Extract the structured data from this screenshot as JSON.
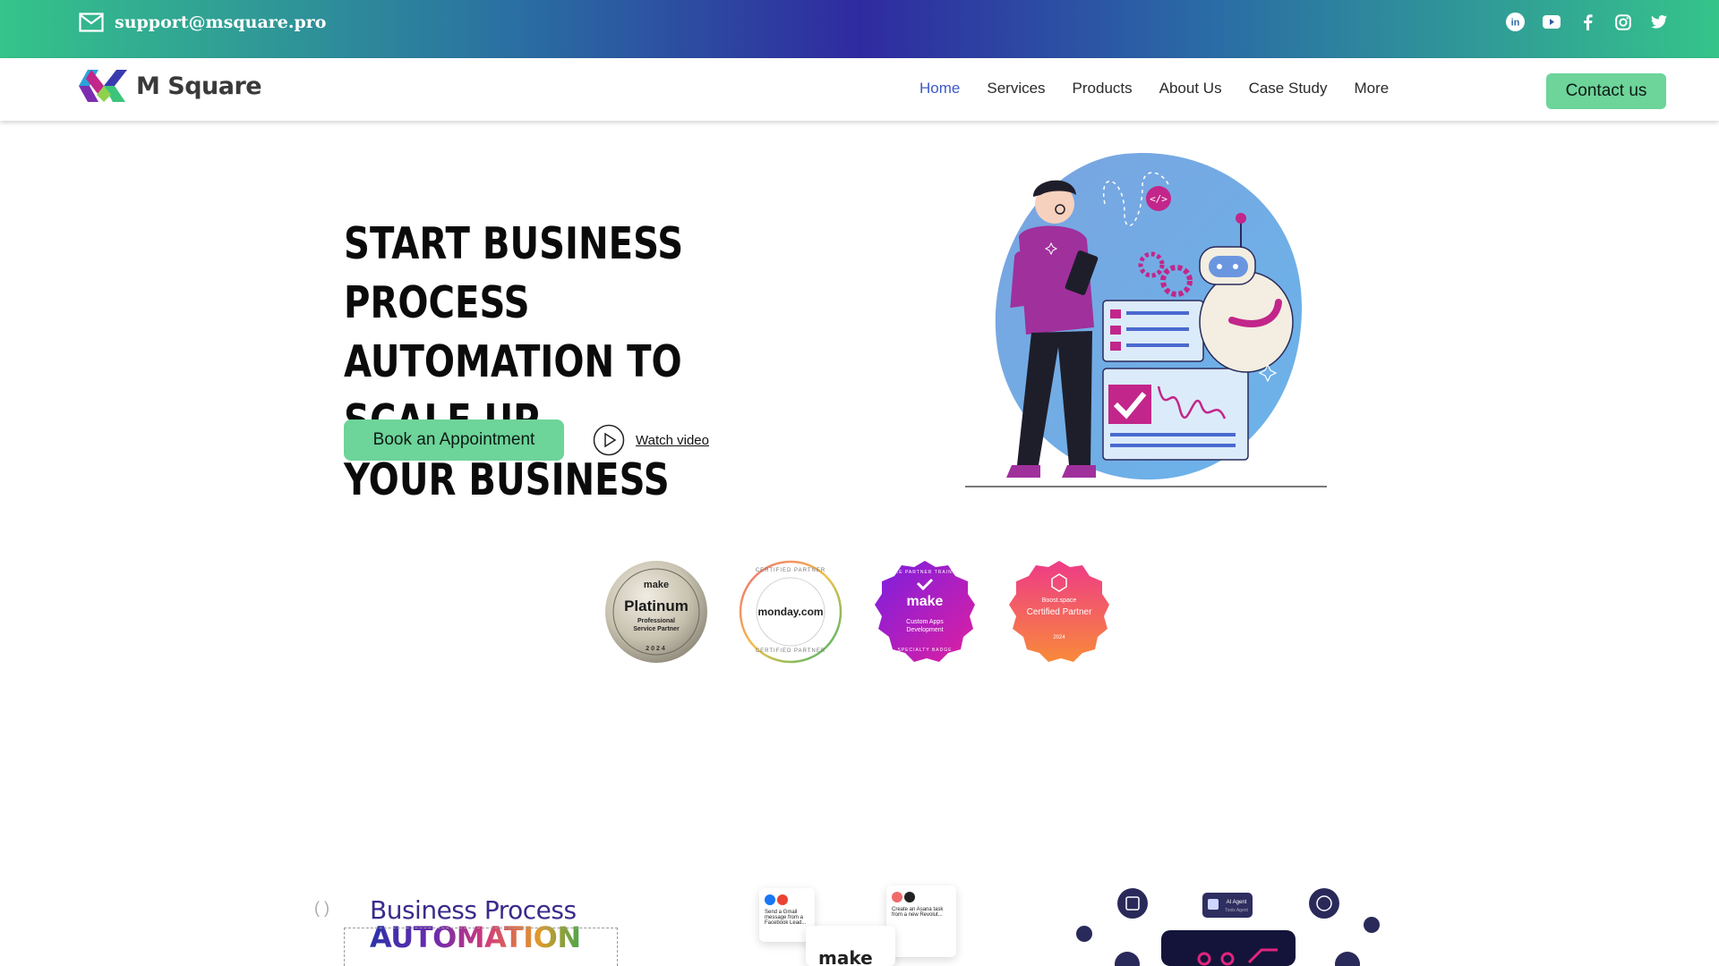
{
  "topbar": {
    "email": "support@msquare.pro",
    "social": [
      "linkedin-icon",
      "youtube-icon",
      "facebook-icon",
      "instagram-icon",
      "twitter-icon"
    ]
  },
  "nav": {
    "brand": "M Square",
    "items": [
      "Home",
      "Services",
      "Products",
      "About Us",
      "Case Study",
      "More"
    ],
    "active": "Home",
    "contact_label": "Contact us"
  },
  "hero": {
    "title_lines": [
      "START BUSINESS PROCESS",
      "AUTOMATION TO SCALE UP",
      "YOUR BUSINESS"
    ],
    "book_label": "Book an Appointment",
    "watch_label": "Watch video"
  },
  "badges": [
    {
      "brand": "make",
      "title": "Platinum",
      "sub1": "Professional",
      "sub2": "Service Partner",
      "year": "2024"
    },
    {
      "brand": "monday.com",
      "ring_top": "CERTIFIED PARTNER",
      "ring_bottom": "CERTIFIED PARTNER"
    },
    {
      "brand": "make",
      "ring": "MAKE PARTNER TRAINING",
      "sub1": "Custom Apps",
      "sub2": "Development",
      "ring_bottom": "SPECIALTY BADGE"
    },
    {
      "brand": "Boost.space",
      "title": "Certified Partner",
      "year": "2024"
    }
  ],
  "lower": {
    "bpa_line1": "Business Process",
    "bpa_line2": "AUTOMATION",
    "card1_text": "Send a Gmail message from a Facebook Lead...",
    "card2_text": "Create an Asana task from a new Revolut...",
    "card3_brand": "make",
    "agent_label": "AI Agent",
    "agent_sub": "Tools Agent"
  },
  "colors": {
    "accent_green": "#6dd49a",
    "nav_active": "#3d59c8",
    "topbar_from": "#35c48a",
    "topbar_mid": "#2f2aa0"
  }
}
